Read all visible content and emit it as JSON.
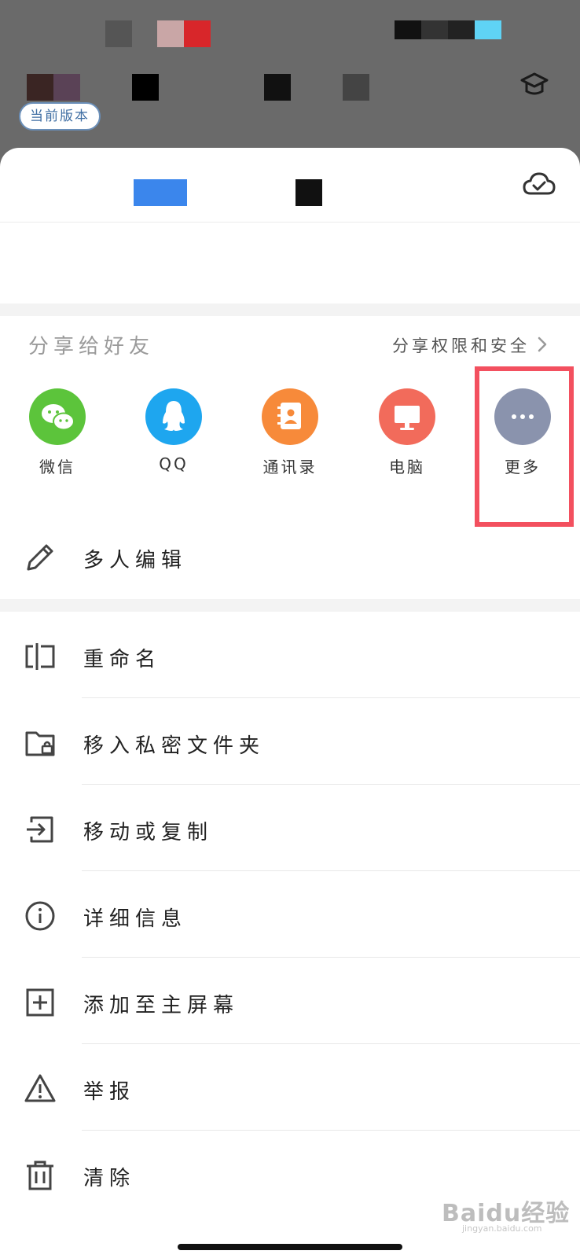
{
  "version_badge": "当前版本",
  "share": {
    "title": "分享给好友",
    "permissions_link": "分享权限和安全",
    "items": [
      {
        "label": "微信",
        "icon": "wechat-icon",
        "color": "#5cc43b"
      },
      {
        "label": "QQ",
        "icon": "qq-icon",
        "color": "#1ea6ef"
      },
      {
        "label": "通讯录",
        "icon": "contacts-icon",
        "color": "#f78a3a"
      },
      {
        "label": "电脑",
        "icon": "computer-icon",
        "color": "#f26b5b"
      },
      {
        "label": "更多",
        "icon": "more-icon",
        "color": "#8a93ad"
      }
    ]
  },
  "menu": [
    {
      "label": "多人编辑",
      "icon": "pencil-icon"
    },
    {
      "label": "重命名",
      "icon": "rename-icon"
    },
    {
      "label": "移入私密文件夹",
      "icon": "private-folder-icon"
    },
    {
      "label": "移动或复制",
      "icon": "move-copy-icon"
    },
    {
      "label": "详细信息",
      "icon": "info-icon"
    },
    {
      "label": "添加至主屏幕",
      "icon": "add-home-icon"
    },
    {
      "label": "举报",
      "icon": "report-warning-icon"
    },
    {
      "label": "清除",
      "icon": "trash-icon"
    }
  ],
  "watermark": {
    "brand": "Baidu经验",
    "domain": "jingyan.baidu.com"
  },
  "colors": {
    "highlight": "#f3505f",
    "badge": "#3f6ea3"
  }
}
